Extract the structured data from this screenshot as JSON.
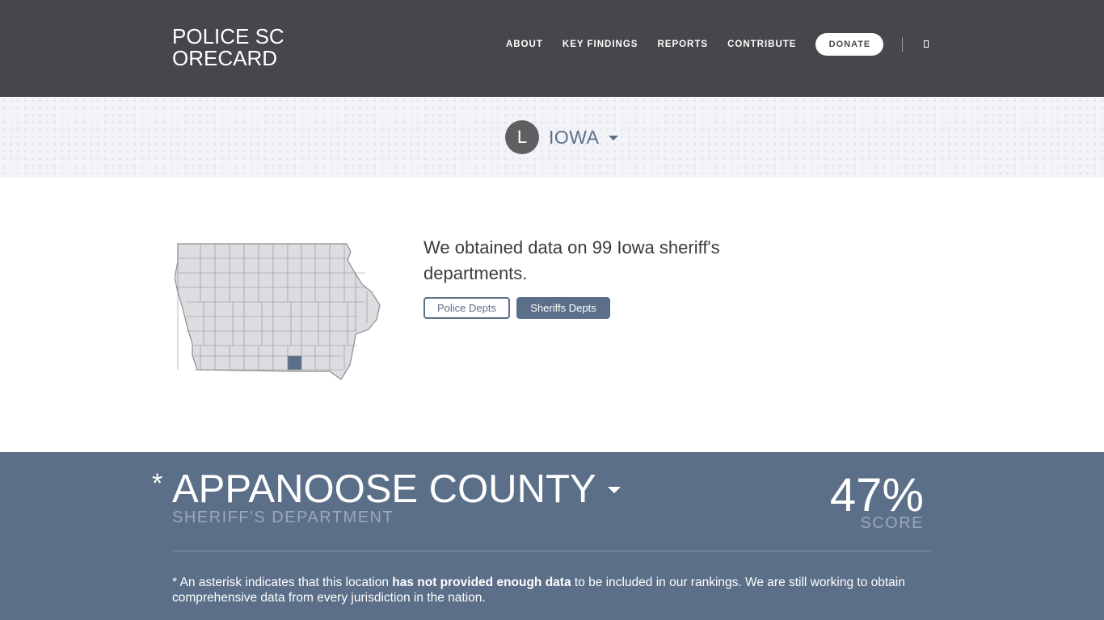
{
  "header": {
    "logo": "POLICE SCORECARD",
    "nav": [
      {
        "label": "ABOUT"
      },
      {
        "label": "KEY FINDINGS"
      },
      {
        "label": "REPORTS"
      },
      {
        "label": "CONTRIBUTE"
      }
    ],
    "donate_label": "DONATE",
    "search_icon": "search-icon"
  },
  "state": {
    "badge_letter": "L",
    "name": "IOWA"
  },
  "summary": {
    "headline": "We obtained data on 99 Iowa sheriff's departments.",
    "toggle_police": "Police Depts",
    "toggle_sheriffs": "Sheriffs Depts",
    "active_toggle": "Sheriffs Depts"
  },
  "map": {
    "state": "Iowa",
    "highlight_county": "Appanoose",
    "fill_color": "#dcdde0",
    "stroke_color": "#8d8d90",
    "highlight_color": "#5b6f88"
  },
  "department": {
    "asterisk": "*",
    "name": "APPANOOSE COUNTY",
    "type": "SHERIFF'S DEPARTMENT",
    "score": "47%",
    "score_label": "SCORE"
  },
  "note": {
    "prefix": "* An asterisk indicates that this location ",
    "bold": "has not provided enough data",
    "suffix": " to be included in our rankings. We are still working to obtain comprehensive data from every jurisdiction in the nation."
  },
  "colors": {
    "header_bg": "#46464b",
    "accent": "#5b6f88",
    "band_bg": "#f2f4f7"
  }
}
